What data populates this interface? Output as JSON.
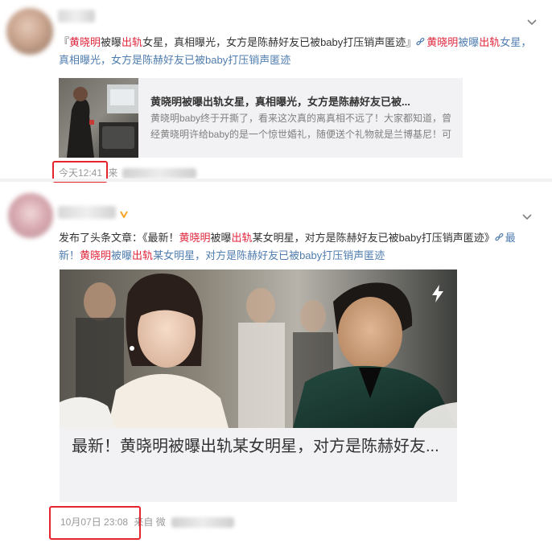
{
  "post1": {
    "text_segments": [
      {
        "text": "『",
        "style": "plain"
      },
      {
        "text": "黄晓明",
        "style": "red"
      },
      {
        "text": "被曝",
        "style": "plain"
      },
      {
        "text": "出轨",
        "style": "red"
      },
      {
        "text": "女星，真相曝光，女方是陈赫好友已被baby打压销声匿迹』",
        "style": "plain"
      }
    ],
    "link_segments": [
      {
        "text": "黄晓明",
        "style": "red"
      },
      {
        "text": "被曝",
        "style": "blue"
      },
      {
        "text": "出轨",
        "style": "red"
      },
      {
        "text": "女星，真相曝光，女方是陈赫好友已被baby打压销声匿迹",
        "style": "blue"
      }
    ],
    "card": {
      "title": "黄晓明被曝出轨女星，真相曝光，女方是陈赫好友已被...",
      "description": "黄晓明baby终于开撕了，看来这次真的离真相不远了！大家都知道，曾经黄晓明许给baby的是一个惊世婚礼，随便送个礼物就是兰博基尼！可"
    },
    "time": "今天12:41",
    "from_label": "来"
  },
  "post2": {
    "text_segments": [
      {
        "text": "发布了头条文章：《最新！",
        "style": "plain"
      },
      {
        "text": "黄晓明",
        "style": "red"
      },
      {
        "text": "被曝",
        "style": "plain"
      },
      {
        "text": "出轨",
        "style": "red"
      },
      {
        "text": "某女明星，对方是陈赫好友已被baby打压销声匿迹》",
        "style": "plain"
      }
    ],
    "link_segments": [
      {
        "text": "最新！",
        "style": "blue"
      },
      {
        "text": "黄晓明",
        "style": "red"
      },
      {
        "text": "被曝",
        "style": "blue"
      },
      {
        "text": "出轨",
        "style": "red"
      },
      {
        "text": "某女明星，对方是陈赫好友已被baby打压销声匿迹",
        "style": "blue"
      }
    ],
    "article": {
      "title": "最新！黄晓明被曝出轨某女明星，对方是陈赫好友..."
    },
    "time": "10月07日 23:08",
    "from_label": "来自 微"
  },
  "colors": {
    "highlight_red": "#e0263c",
    "link_blue": "#507daf",
    "annotation_box_red": "#e5252b",
    "card_background": "#f2f2f5",
    "meta_gray": "#999999"
  },
  "icons": {
    "menu": "chevron-down-icon",
    "link": "link-chain-icon",
    "article_badge": "lightning-icon",
    "verified": "vip-badge-icon"
  }
}
